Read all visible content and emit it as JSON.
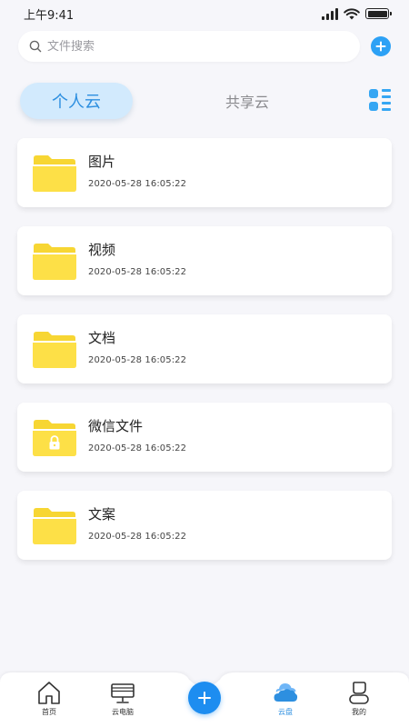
{
  "status_bar": {
    "time": "上午9:41"
  },
  "search": {
    "placeholder": "文件搜索"
  },
  "tabs": {
    "personal": "个人云",
    "shared": "共享云"
  },
  "files": [
    {
      "name": "图片",
      "date": "2020-05-28 16:05:22",
      "icon": "folder-icon"
    },
    {
      "name": "视频",
      "date": "2020-05-28 16:05:22",
      "icon": "folder-icon"
    },
    {
      "name": "文档",
      "date": "2020-05-28 16:05:22",
      "icon": "folder-icon"
    },
    {
      "name": "微信文件",
      "date": "2020-05-28 16:05:22",
      "icon": "locked-folder-icon"
    },
    {
      "name": "文案",
      "date": "2020-05-28 16:05:22",
      "icon": "folder-icon"
    }
  ],
  "bottom_nav": {
    "home": "首页",
    "cloud_pc": "云电脑",
    "cloud_disk": "云盘",
    "mine": "我的"
  },
  "colors": {
    "accent": "#2da1f5",
    "active_tab_bg": "#d2eafd",
    "folder": "#fde047",
    "background": "#f6f6fa"
  }
}
